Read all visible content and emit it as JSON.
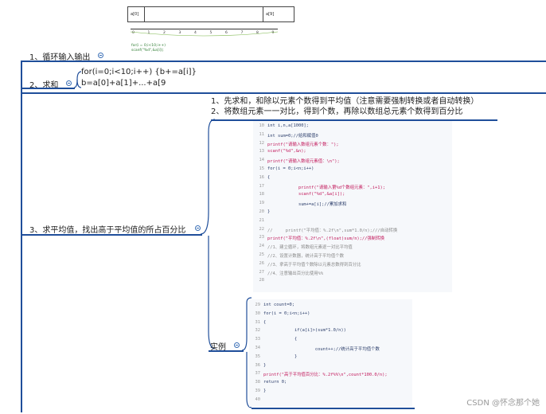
{
  "diagram": {
    "left_label": "a[0]",
    "right_label": "a[9]",
    "axis_ticks": [
      "0",
      "1",
      "2",
      "3",
      "4",
      "5",
      "6",
      "7",
      "8",
      "9"
    ],
    "caption_line1": "for(i = 0;i<10;i++)",
    "caption_line2": "scanf(\"%d\",&a[i]);"
  },
  "nodes": {
    "n1": {
      "label": "1、循环输入输出"
    },
    "n2": {
      "label": "2、求和",
      "note1": "for(i=0;i<10;i++)   {b+=a[i]}",
      "note2": "b=a[0]+a[1]+...+a[9"
    },
    "n3": {
      "label": "3、求平均值，找出高于平均值的所占百分比",
      "note1": "1、先求和，和除以元素个数得到平均值（注意需要强制转换或者自动转换）",
      "note2": "2、将数组元素一一对比，得到个数，再除以数组总元素个数得到百分比"
    },
    "example": {
      "label": "实例"
    }
  },
  "code_block_1": {
    "lines": [
      {
        "n": "10",
        "t": "int i,n,a[1000];"
      },
      {
        "n": "11",
        "t": "int sum=0;//给和赋值0"
      },
      {
        "n": "12",
        "t": "printf(\"请输入数组元素个数：\");"
      },
      {
        "n": "13",
        "t": "scanf(\"%d\",&n);"
      },
      {
        "n": "14",
        "t": "printf(\"请输入数组元素值：\\n\");"
      },
      {
        "n": "15",
        "t": "for(i = 0;i<n;i++)"
      },
      {
        "n": "16",
        "t": "{"
      },
      {
        "n": "17",
        "t": "            printf(\"请输入第%d个数组元素：\",i+1);"
      },
      {
        "n": "18",
        "t": "            scanf(\"%d\",&a[i]);"
      },
      {
        "n": "19",
        "t": "            sum+=a[i];//累加求和"
      },
      {
        "n": "20",
        "t": "}"
      },
      {
        "n": "21",
        "t": ""
      },
      {
        "n": "22",
        "t": "//     printf(\"平均值：%.2f\\n\",sum*1.0/n);///自动转换"
      },
      {
        "n": "23",
        "t": "printf(\"平均值：%.2f\\n\",(float)sum/n);//强制转换"
      },
      {
        "n": "24",
        "t": "//1、建立循环，将数组元素逐一对比平均值"
      },
      {
        "n": "25",
        "t": "//2、设置计数器，统计高于平均值个数"
      },
      {
        "n": "26",
        "t": "//3、拿高于平均值个数除以元素总数得到百分比"
      },
      {
        "n": "27",
        "t": "//4、注意输出百分比使用%%"
      },
      {
        "n": "28",
        "t": ""
      }
    ]
  },
  "code_block_2": {
    "lines": [
      {
        "n": "29",
        "t": "int count=0;"
      },
      {
        "n": "30",
        "t": "for(i = 0;i<n;i++)"
      },
      {
        "n": "31",
        "t": "{"
      },
      {
        "n": "32",
        "t": "            if(a[i]>(sum*1.0/n))"
      },
      {
        "n": "33",
        "t": "            {"
      },
      {
        "n": "34",
        "t": "                    count++;//统计高于平均值个数"
      },
      {
        "n": "35",
        "t": "            }"
      },
      {
        "n": "36",
        "t": "}"
      },
      {
        "n": "37",
        "t": "printf(\"高于平均值百分比：%.2f%%\\n\",count*100.0/n);"
      },
      {
        "n": "38",
        "t": "return 0;"
      },
      {
        "n": "39",
        "t": "}"
      },
      {
        "n": "40",
        "t": ""
      }
    ]
  },
  "watermark": "CSDN @怀念那个她",
  "colors": {
    "branch": "#1f4e9a",
    "collapse": "#3a6fb6"
  }
}
